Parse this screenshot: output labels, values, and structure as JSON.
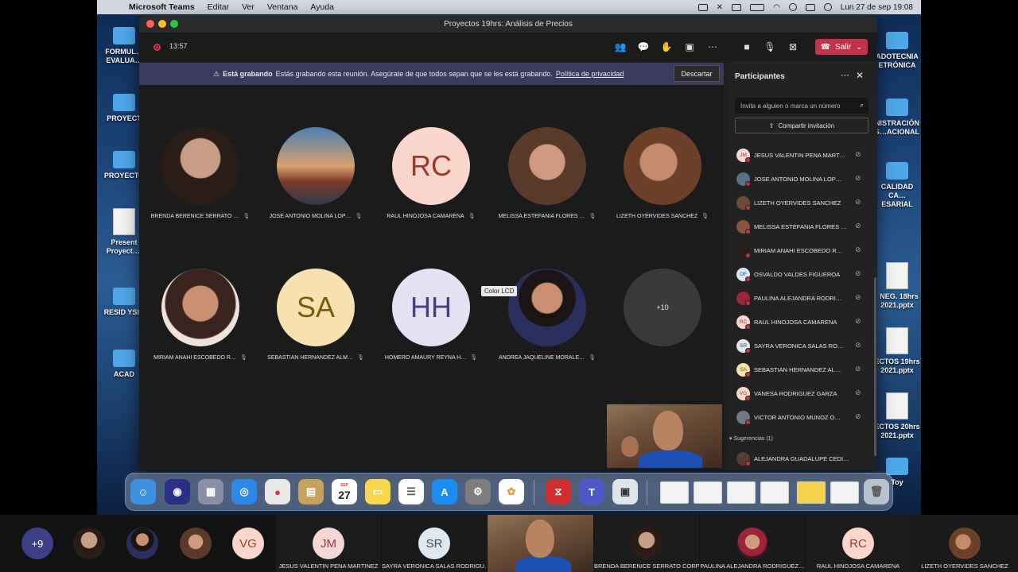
{
  "menubar": {
    "app": "Microsoft Teams",
    "items": [
      "Editar",
      "Ver",
      "Ventana",
      "Ayuda"
    ],
    "datetime": "Lun 27 de sep  19:08"
  },
  "desktop": {
    "icons": [
      {
        "label": "FORMUL… EVALUA…"
      },
      {
        "label": "PROYECT"
      },
      {
        "label": "PROYECTO"
      },
      {
        "label": "Present Proyect…i"
      },
      {
        "label": "RESID YSID"
      },
      {
        "label": "ACAD"
      },
      {
        "label": "ADOTECNIA ETRÓNICA"
      },
      {
        "label": "NISTRACIÓN S…ACIONAL"
      },
      {
        "label": "CALIDAD CA…ESARIAL"
      },
      {
        "label": ". NEG. 18hrs 2021.pptx"
      },
      {
        "label": "ECTOS 19hrs 2021.pptx"
      },
      {
        "label": "ECTOS 20hrs 2021.pptx"
      },
      {
        "label": "Toy"
      }
    ]
  },
  "window": {
    "title": "Proyectos 19hrs: Análisis de Precios"
  },
  "callbar": {
    "timer": "13:57",
    "leave_label": "Salir"
  },
  "banner": {
    "title": "Está grabando",
    "message": "Estás grabando esta reunión. Asegúrate de que todos sepan que se les está grabando.",
    "link": "Política de privacidad",
    "dismiss": "Descartar"
  },
  "tooltip": "Color LCD",
  "tiles": [
    {
      "name": "BRENDA BERENICE SERRATO …",
      "initials": "",
      "bg": "#3a2a24"
    },
    {
      "name": "JOSE ANTONIO MOLINA LOP…",
      "initials": "",
      "bg": "#5a6f8a"
    },
    {
      "name": "RAUL HINOJOSA CAMARENA",
      "initials": "RC",
      "bg": "#fbd6cc"
    },
    {
      "name": "MELISSA ESTEFANIA FLORES …",
      "initials": "",
      "bg": "#8a5540"
    },
    {
      "name": "LIZETH OYERVIDES SANCHEZ",
      "initials": "",
      "bg": "#6d4a34"
    },
    {
      "name": "MIRIAM ANAHI ESCOBEDO R…",
      "initials": "",
      "bg": "#2a1c1a"
    },
    {
      "name": "SEBASTIAN HERNANDEZ ALM…",
      "initials": "SA",
      "bg": "#f7e1b0"
    },
    {
      "name": "HOMERO AMAURY REYNA H…",
      "initials": "HH",
      "bg": "#e5e0f2"
    },
    {
      "name": "ANDREA JAQUELINE MORALE…",
      "initials": "",
      "bg": "#efe8e4"
    },
    {
      "name": "",
      "initials": "+10",
      "bg": "#3a3a3a"
    }
  ],
  "panel": {
    "title": "Participantes",
    "invite_placeholder": "Invita a alguien o marca un número",
    "share_label": "Compartir invitación",
    "participants": [
      {
        "initials": "JM",
        "name": "JESUS VALENTIN PENA MART…",
        "bg": "#f5d7d7",
        "fg": "#9a3a3a"
      },
      {
        "initials": "",
        "name": "JOSE ANTONIO MOLINA LOP…",
        "bg": "#5a6f8a",
        "fg": "#fff"
      },
      {
        "initials": "",
        "name": "LIZETH OYERVIDES SANCHEZ",
        "bg": "#6d4a34",
        "fg": "#fff"
      },
      {
        "initials": "",
        "name": "MELISSA ESTEFANIA FLORES …",
        "bg": "#8a5540",
        "fg": "#fff"
      },
      {
        "initials": "",
        "name": "MIRIAM ANAHI ESCOBEDO R…",
        "bg": "#2a1c1a",
        "fg": "#fff"
      },
      {
        "initials": "OF",
        "name": "OSVALDO VALDES FIGUEROA",
        "bg": "#dde6f7",
        "fg": "#35508a"
      },
      {
        "initials": "",
        "name": "PAULINA ALEJANDRA RODRI…",
        "bg": "#9a2438",
        "fg": "#fff"
      },
      {
        "initials": "RC",
        "name": "RAUL HINOJOSA CAMARENA",
        "bg": "#fbd6cc",
        "fg": "#9a3a2a"
      },
      {
        "initials": "SR",
        "name": "SAYRA VERONICA SALAS RO…",
        "bg": "#dfe7ef",
        "fg": "#3a4a5a"
      },
      {
        "initials": "SA",
        "name": "SEBASTIAN HERNANDEZ AL…",
        "bg": "#f7e1b0",
        "fg": "#7a5a10"
      },
      {
        "initials": "VG",
        "name": "VANESA RODRIGUEZ GARZA",
        "bg": "#fbd6cc",
        "fg": "#9a3a2a"
      },
      {
        "initials": "",
        "name": "VICTOR ANTONIO MUNOZ O…",
        "bg": "#707a86",
        "fg": "#fff"
      }
    ],
    "suggestions_label": "Sugerencias (1)",
    "suggestion": {
      "initials": "",
      "name": "ALEJANDRA GUADALUPE CEDILL…",
      "bg": "#5a3a32",
      "fg": "#fff"
    }
  },
  "dock": {
    "calendar_month": "SEP",
    "calendar_day": "27"
  },
  "strip": {
    "more_label": "+9",
    "tiles": [
      {
        "initials": "VG",
        "label": "",
        "bg": "#fbd6cc"
      },
      {
        "initials": "JM",
        "label": "JESUS VALENTIN PENA MARTINEZ",
        "bg": "#f5d7d7"
      },
      {
        "initials": "SR",
        "label": "SAYRA  VERONICA SALAS RODRIGU…",
        "bg": "#dfe7ef"
      },
      {
        "initials": "",
        "label": "BRENDA BERENICE SERRATO CORP…",
        "bg": ""
      },
      {
        "initials": "",
        "label": "PAULINA  ALEJANDRA  RODRIGUEZ…",
        "bg": ""
      },
      {
        "initials": "RC",
        "label": "RAUL HINOJOSA CAMARENA",
        "bg": "#fbd6cc"
      },
      {
        "initials": "",
        "label": "LIZETH OYERVIDES SANCHEZ",
        "bg": ""
      }
    ]
  }
}
